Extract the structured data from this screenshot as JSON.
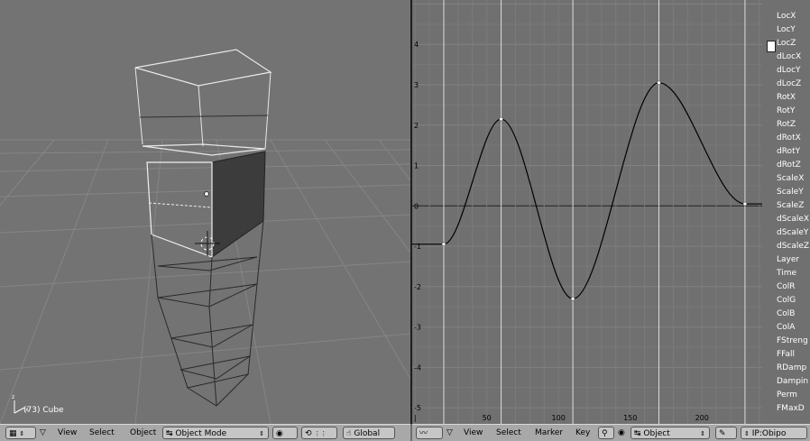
{
  "viewport": {
    "frame_label": "(73) Cube",
    "axis_z": "z",
    "axis_x": "x"
  },
  "ipo_channels": [
    "LocX",
    "LocY",
    "LocZ",
    "dLocX",
    "dLocY",
    "dLocZ",
    "RotX",
    "RotY",
    "RotZ",
    "dRotX",
    "dRotY",
    "dRotZ",
    "ScaleX",
    "ScaleY",
    "ScaleZ",
    "dScaleX",
    "dScaleY",
    "dScaleZ",
    "Layer",
    "Time",
    "ColR",
    "ColG",
    "ColB",
    "ColA",
    "FStreng",
    "FFall",
    "RDamp",
    "Dampin",
    "Perm",
    "FMaxD"
  ],
  "header_left": {
    "menus": [
      "View",
      "Select",
      "Object"
    ],
    "mode_label": "Object Mode",
    "orientation_label": "Global"
  },
  "header_right": {
    "menus": [
      "View",
      "Select",
      "Marker",
      "Key"
    ],
    "object_label": "Object",
    "ipo_label": "IP:Obipo"
  },
  "chart_data": {
    "type": "line",
    "xlabel": "",
    "ylabel": "",
    "x_ticks": [
      50,
      100,
      150,
      200
    ],
    "y_ticks": [
      -5,
      -4,
      -3,
      -2,
      -1,
      0,
      1,
      2,
      3,
      4
    ],
    "xlim": [
      -2,
      242
    ],
    "ylim": [
      -5.4,
      5.1
    ],
    "series": [
      {
        "name": "LocZ",
        "keyframes": [
          [
            20,
            -0.95
          ],
          [
            60,
            2.15
          ],
          [
            110,
            -2.3
          ],
          [
            170,
            3.05
          ],
          [
            230,
            0.05
          ]
        ]
      }
    ]
  },
  "colors": {
    "curve": "#000000",
    "keyframe": "#ffffff",
    "grid": "#7e7e7e",
    "viewport_bg": "#737373",
    "header_bg": "#a8a8a8"
  }
}
